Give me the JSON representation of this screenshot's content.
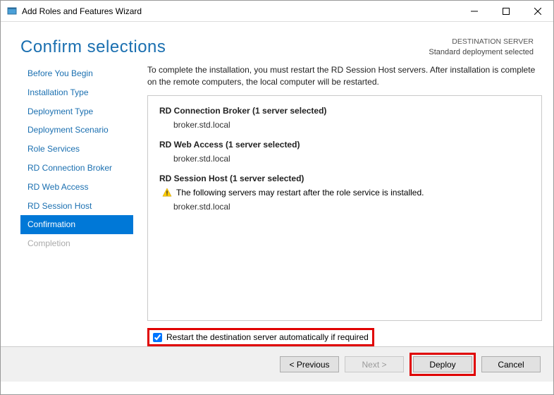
{
  "window": {
    "title": "Add Roles and Features Wizard"
  },
  "header": {
    "title": "Confirm selections",
    "destination_label": "DESTINATION SERVER",
    "destination_value": "Standard deployment selected"
  },
  "nav": {
    "items": [
      {
        "label": "Before You Begin",
        "state": "normal"
      },
      {
        "label": "Installation Type",
        "state": "normal"
      },
      {
        "label": "Deployment Type",
        "state": "normal"
      },
      {
        "label": "Deployment Scenario",
        "state": "normal"
      },
      {
        "label": "Role Services",
        "state": "normal"
      },
      {
        "label": "RD Connection Broker",
        "state": "normal"
      },
      {
        "label": "RD Web Access",
        "state": "normal"
      },
      {
        "label": "RD Session Host",
        "state": "normal"
      },
      {
        "label": "Confirmation",
        "state": "selected"
      },
      {
        "label": "Completion",
        "state": "disabled"
      }
    ]
  },
  "main": {
    "instructions": "To complete the installation, you must restart the RD Session Host servers. After installation is complete on the remote computers, the local computer will be restarted.",
    "roles": [
      {
        "title": "RD Connection Broker  (1 server selected)",
        "servers": [
          "broker.std.local"
        ]
      },
      {
        "title": "RD Web Access  (1 server selected)",
        "servers": [
          "broker.std.local"
        ]
      },
      {
        "title": "RD Session Host  (1 server selected)",
        "warning": "The following servers may restart after the role service is installed.",
        "servers": [
          "broker.std.local"
        ]
      }
    ],
    "restart_checkbox_label": "Restart the destination server automatically if required",
    "restart_checked": true
  },
  "footer": {
    "previous": "< Previous",
    "next": "Next >",
    "deploy": "Deploy",
    "cancel": "Cancel"
  }
}
